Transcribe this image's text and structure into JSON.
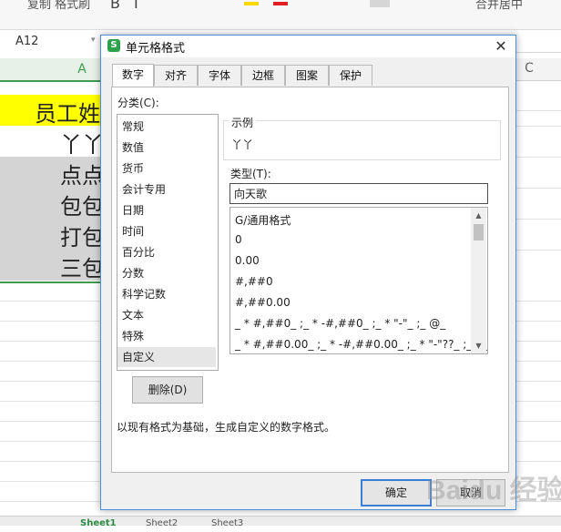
{
  "ribbon": {
    "left_text": "复制 格式刷",
    "right_text": "合并居中"
  },
  "namebox": {
    "value": "A12",
    "caret": "▾"
  },
  "columns": {
    "a": "A",
    "c": "C"
  },
  "cells": [
    "员工姓",
    "丫丫",
    "点点",
    "包包",
    "打包",
    "三包"
  ],
  "sheet_tabs": [
    "Sheet1",
    "Sheet2",
    "Sheet3"
  ],
  "dialog": {
    "title": "单元格格式",
    "logo": "S",
    "close": "✕",
    "tabs": [
      "数字",
      "对齐",
      "字体",
      "边框",
      "图案",
      "保护"
    ],
    "category_label": "分类(C):",
    "categories": [
      "常规",
      "数值",
      "货币",
      "会计专用",
      "日期",
      "时间",
      "百分比",
      "分数",
      "科学记数",
      "文本",
      "特殊",
      "自定义"
    ],
    "selected_category": "自定义",
    "sample_label": "示例",
    "sample_value": "丫丫",
    "type_label": "类型(T):",
    "type_value": "向天歌",
    "formats": [
      "G/通用格式",
      "0",
      "0.00",
      "#,##0",
      "#,##0.00",
      "_ * #,##0_ ;_ * -#,##0_ ;_ * \"-\"_ ;_ @_",
      "_ * #,##0.00_ ;_ * -#,##0.00_ ;_ * \"-\"??_ ;_ @_"
    ],
    "delete_button": "删除(D)",
    "description": "以现有格式为基础，生成自定义的数字格式。",
    "ok_button": "确定",
    "cancel_button": "取消"
  },
  "watermark": "Baidu 经验",
  "colors": {
    "accent_green": "#3f9b50",
    "header_yellow": "#ffff00",
    "focus_blue": "#3c7fd9"
  }
}
